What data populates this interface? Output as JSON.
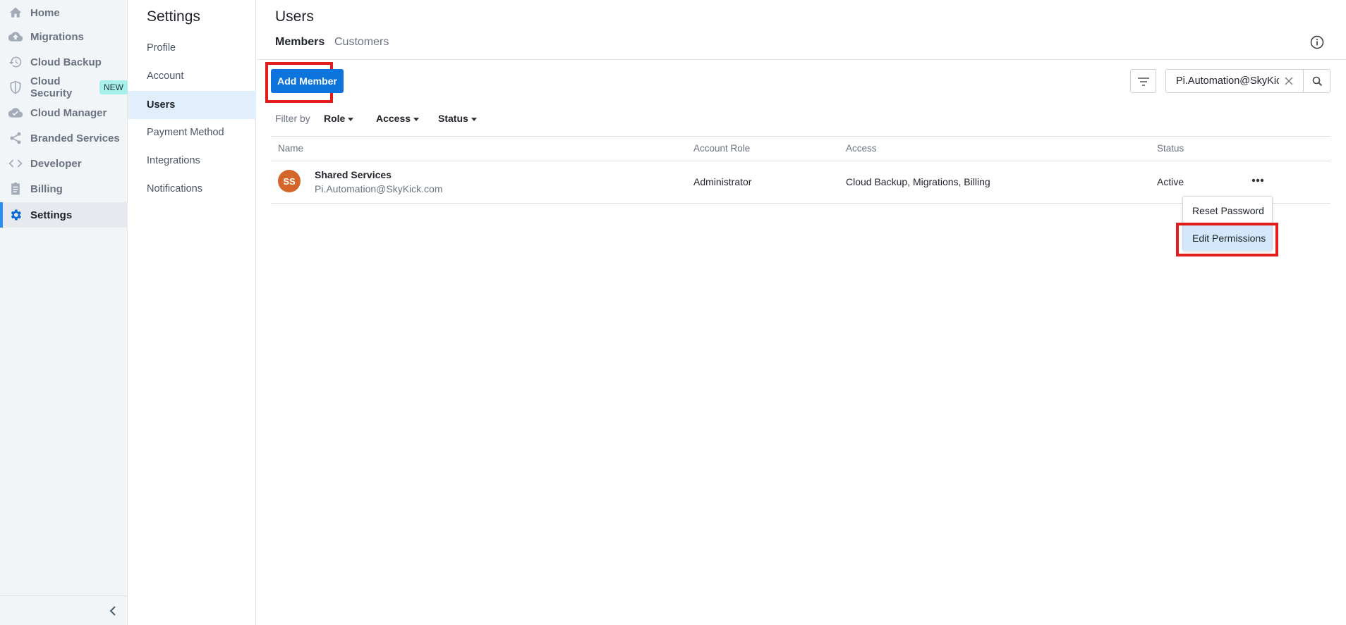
{
  "nav": {
    "items": [
      {
        "label": "Home",
        "icon": "home-icon"
      },
      {
        "label": "Migrations",
        "icon": "cloud-upload-icon"
      },
      {
        "label": "Cloud Backup",
        "icon": "history-icon"
      },
      {
        "label": "Cloud Security",
        "icon": "shield-icon",
        "badge": "NEW"
      },
      {
        "label": "Cloud Manager",
        "icon": "cloud-check-icon"
      },
      {
        "label": "Branded Services",
        "icon": "share-icon"
      },
      {
        "label": "Developer",
        "icon": "code-icon"
      },
      {
        "label": "Billing",
        "icon": "clipboard-icon"
      },
      {
        "label": "Settings",
        "icon": "gear-icon",
        "active": true
      }
    ]
  },
  "settings": {
    "title": "Settings",
    "items": [
      "Profile",
      "Account",
      "Users",
      "Payment Method",
      "Integrations",
      "Notifications"
    ],
    "active": "Users"
  },
  "main": {
    "title": "Users",
    "tabs": [
      "Members",
      "Customers"
    ],
    "active_tab": "Members",
    "add_member": "Add Member",
    "search_value": "Pi.Automation@SkyKick.com",
    "filter_by": "Filter by",
    "filters": [
      "Role",
      "Access",
      "Status"
    ],
    "columns": [
      "Name",
      "Account Role",
      "Access",
      "Status"
    ],
    "rows": [
      {
        "initials": "SS",
        "name": "Shared Services",
        "email": "Pi.Automation@SkyKick.com",
        "role": "Administrator",
        "access": "Cloud Backup, Migrations, Billing",
        "status": "Active",
        "avatar_color": "#d5662b"
      }
    ],
    "menu": [
      "Reset Password",
      "Edit Permissions"
    ]
  },
  "colors": {
    "accent": "#0d74dd",
    "highlight": "#e21b1b"
  }
}
